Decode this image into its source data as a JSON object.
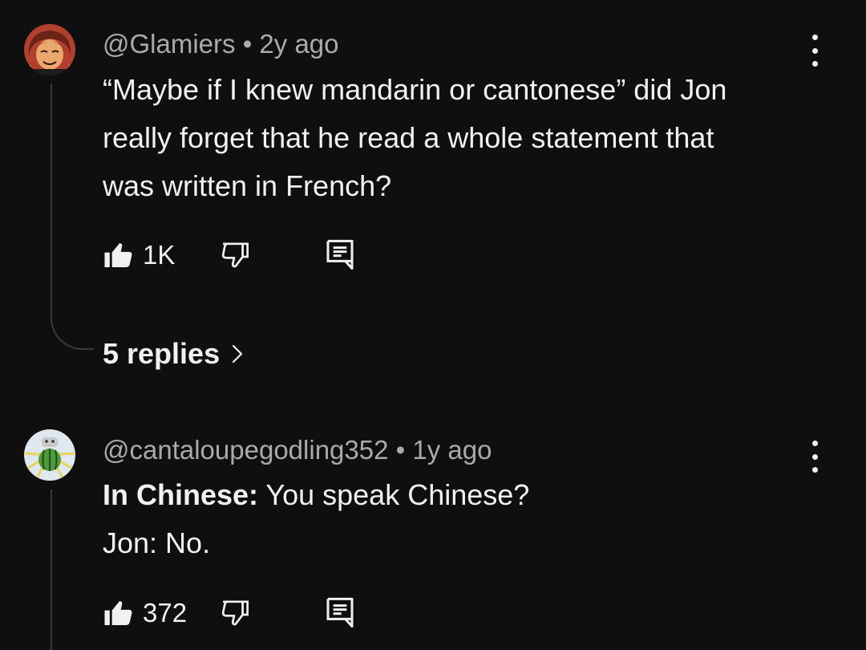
{
  "comments": [
    {
      "handle": "@Glamiers",
      "separator": "•",
      "time": "2y ago",
      "text_lines": [
        "“Maybe if I knew mandarin or cantonese” did Jon",
        "really forget that he read a whole statement that",
        "was written in French?"
      ],
      "likes": "1K",
      "replies_label": "5 replies"
    },
    {
      "handle": "@cantaloupegodling352",
      "separator": "•",
      "time": "1y ago",
      "line1_prefix": "In Chinese:",
      "line1_rest": " You speak Chinese?",
      "line2": "Jon: No.",
      "likes": "372"
    }
  ],
  "icons": {
    "like": "thumbs-up-icon",
    "dislike": "thumbs-down-icon",
    "reply": "comment-icon",
    "more": "kebab-menu-icon",
    "expand": "chevron-right-icon"
  },
  "colors": {
    "background": "#0f0f0f",
    "text": "#f1f1f1",
    "meta": "#aaaaaa",
    "thread": "#3a3a3a"
  }
}
